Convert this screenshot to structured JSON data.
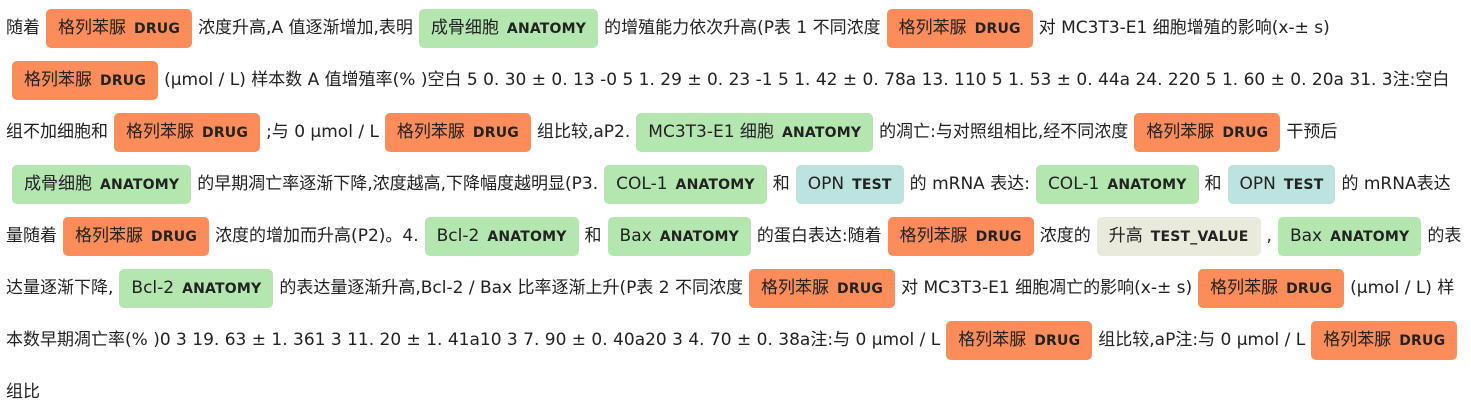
{
  "labels": {
    "drug": "DRUG",
    "anatomy": "ANATOMY",
    "test": "TEST",
    "test_value": "TEST_VALUE"
  },
  "segments": [
    {
      "t": "随着"
    },
    {
      "e": "格列苯脲",
      "l": "drug"
    },
    {
      "t": "浓度升高,A 值逐渐增加,表明"
    },
    {
      "e": "成骨细胞",
      "l": "anatomy"
    },
    {
      "t": "的增殖能力依次升高(P表 1 不同浓度"
    },
    {
      "e": "格列苯脲",
      "l": "drug"
    },
    {
      "t": "对 MC3T3-E1 细胞增殖的影响(x-± s)"
    },
    {
      "e": "格列苯脲",
      "l": "drug"
    },
    {
      "t": "(μmol / L) 样本数 A 值增殖率(% )空白 5 0. 30 ± 0. 13 -0 5 1. 29 ± 0. 23 -1 5 1. 42 ± 0. 78a 13. 110 5 1. 53 ± 0. 44a 24. 220 5 1. 60 ± 0. 20a 31. 3注:空白组不加细胞和"
    },
    {
      "e": "格列苯脲",
      "l": "drug"
    },
    {
      "t": ";与 0 μmol / L"
    },
    {
      "e": "格列苯脲",
      "l": "drug"
    },
    {
      "t": "组比较,aP2."
    },
    {
      "e": "MC3T3-E1 细胞",
      "l": "anatomy"
    },
    {
      "t": "的凋亡:与对照组相比,经不同浓度"
    },
    {
      "e": "格列苯脲",
      "l": "drug"
    },
    {
      "t": "干预后"
    },
    {
      "e": "成骨细胞",
      "l": "anatomy"
    },
    {
      "t": "的早期凋亡率逐渐下降,浓度越高,下降幅度越明显(P3."
    },
    {
      "e": "COL-1",
      "l": "anatomy"
    },
    {
      "t": "和"
    },
    {
      "e": "OPN",
      "l": "test"
    },
    {
      "t": "的 mRNA 表达:"
    },
    {
      "e": "COL-1",
      "l": "anatomy"
    },
    {
      "t": "和"
    },
    {
      "e": "OPN",
      "l": "test"
    },
    {
      "t": "的 mRNA表达量随着"
    },
    {
      "e": "格列苯脲",
      "l": "drug"
    },
    {
      "t": "浓度的增加而升高(P2)。4."
    },
    {
      "e": "Bcl-2",
      "l": "anatomy"
    },
    {
      "t": "和"
    },
    {
      "e": "Bax",
      "l": "anatomy"
    },
    {
      "t": "的蛋白表达:随着"
    },
    {
      "e": "格列苯脲",
      "l": "drug"
    },
    {
      "t": "浓度的"
    },
    {
      "e": "升高",
      "l": "test_value"
    },
    {
      "t": ","
    },
    {
      "e": "Bax",
      "l": "anatomy"
    },
    {
      "t": "的表达量逐渐下降,"
    },
    {
      "e": "Bcl-2",
      "l": "anatomy"
    },
    {
      "t": "的表达量逐渐升高,Bcl-2 / Bax 比率逐渐上升(P表 2 不同浓度"
    },
    {
      "e": "格列苯脲",
      "l": "drug"
    },
    {
      "t": "对 MC3T3-E1 细胞凋亡的影响(x-± s)"
    },
    {
      "e": "格列苯脲",
      "l": "drug"
    },
    {
      "t": "(μmol / L) 样本数早期凋亡率(% )0 3 19. 63 ± 1. 361 3 11. 20 ± 1. 41a10 3 7. 90 ± 0. 40a20 3 4. 70 ± 0. 38a注:与 0 μmol / L"
    },
    {
      "e": "格列苯脲",
      "l": "drug"
    },
    {
      "t": "组比较,aP注:与 0 μmol / L"
    },
    {
      "e": "格列苯脲",
      "l": "drug"
    },
    {
      "t": "组比"
    }
  ]
}
